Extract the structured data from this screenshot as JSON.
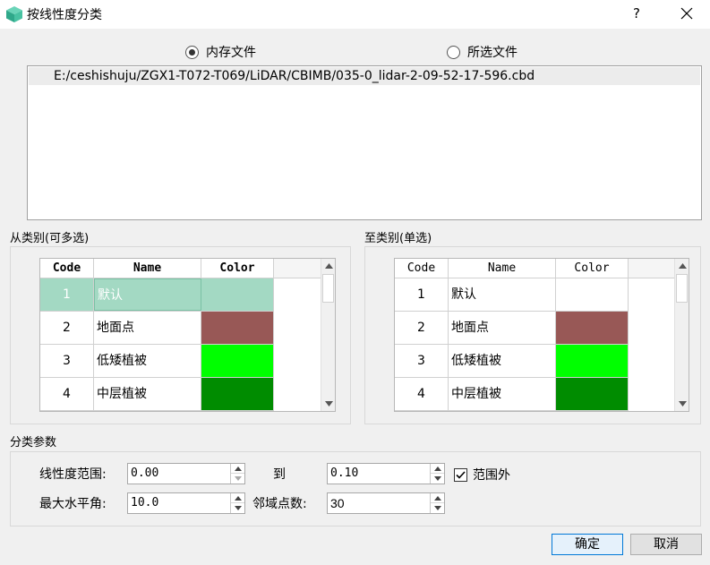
{
  "window": {
    "title": "按线性度分类",
    "help_label": "?",
    "icons": {
      "app": "cube-app-icon",
      "close": "close-icon"
    }
  },
  "source": {
    "options": [
      {
        "label": "内存文件",
        "checked": true
      },
      {
        "label": "所选文件",
        "checked": false
      }
    ],
    "files": [
      "E:/ceshishuju/ZGX1-T072-T069/LiDAR/CBIMB/035-0_lidar-2-09-52-17-596.cbd"
    ]
  },
  "from_group": {
    "label": "从类别(可多选)",
    "columns": [
      "Code",
      "Name",
      "Color"
    ],
    "rows": [
      {
        "code": "1",
        "name": "默认",
        "color": "#a3d9c3",
        "selected": true
      },
      {
        "code": "2",
        "name": "地面点",
        "color": "#985856",
        "selected": false
      },
      {
        "code": "3",
        "name": "低矮植被",
        "color": "#00ff00",
        "selected": false
      },
      {
        "code": "4",
        "name": "中层植被",
        "color": "#008c00",
        "selected": false
      }
    ]
  },
  "to_group": {
    "label": "至类别(单选)",
    "columns": [
      "Code",
      "Name",
      "Color"
    ],
    "rows": [
      {
        "code": "1",
        "name": "默认",
        "color": "#ffffff"
      },
      {
        "code": "2",
        "name": "地面点",
        "color": "#985856"
      },
      {
        "code": "3",
        "name": "低矮植被",
        "color": "#00ff00"
      },
      {
        "code": "4",
        "name": "中层植被",
        "color": "#008c00"
      }
    ]
  },
  "params": {
    "label": "分类参数",
    "linearity_label": "线性度范围:",
    "linearity_min": "0.00",
    "to_label": "到",
    "linearity_max": "0.10",
    "out_of_range_label": "范围外",
    "out_of_range_checked": true,
    "max_horizontal_angle_label": "最大水平角:",
    "max_horizontal_angle": "10.0",
    "neighbor_count_label": "邻域点数:",
    "neighbor_count": "30"
  },
  "buttons": {
    "ok": "确定",
    "cancel": "取消"
  }
}
